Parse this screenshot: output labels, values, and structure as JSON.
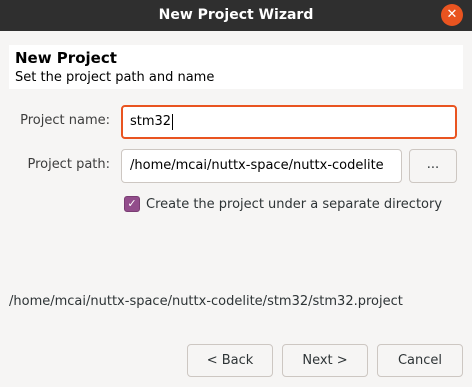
{
  "window": {
    "title": "New Project Wizard",
    "close_glyph": "✕"
  },
  "header": {
    "title": "New Project",
    "subtitle": "Set the project path and name"
  },
  "form": {
    "name_label": "Project name:",
    "name_value": "stm32",
    "path_label": "Project path:",
    "path_value": "/home/mcai/nuttx-space/nuttx-codelite",
    "browse_label": "...",
    "separate_dir_label": "Create the project under a separate directory",
    "separate_dir_checked": true,
    "check_glyph": "✓"
  },
  "summary": {
    "full_path": "/home/mcai/nuttx-space/nuttx-codelite/stm32/stm32.project"
  },
  "buttons": {
    "back": "< Back",
    "next": "Next >",
    "cancel": "Cancel"
  },
  "colors": {
    "titlebar": "#2f2f2f",
    "accent": "#e95420",
    "checkbox": "#924d8b"
  },
  "icons": {
    "close": "close-icon",
    "check": "checkmark-icon"
  }
}
